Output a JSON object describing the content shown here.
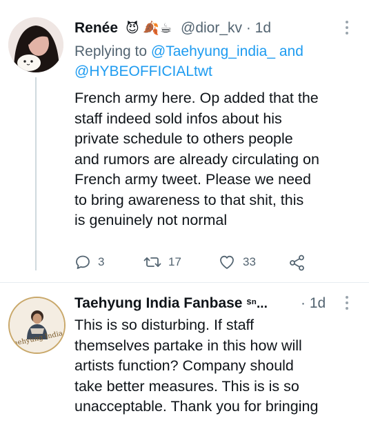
{
  "tweet1": {
    "name": "Renée",
    "emojis": [
      "😈",
      "🍂",
      "☕"
    ],
    "handle": "@dior_kv",
    "time": "· 1d",
    "replying_prefix": "Replying to",
    "replying_to_1": "@Taehyung_india_",
    "replying_and": "and",
    "replying_to_2": "@HYBEOFFICIALtwt",
    "body_lines": [
      "French army here. Op added that the",
      "staff indeed sold infos about his",
      "private schedule to others people",
      "and rumors are already circulating on",
      "French army tweet. Please we need",
      "to bring awareness to that shit, this",
      "is genuinely not normal"
    ],
    "replies": "3",
    "retweets": "17",
    "likes": "33"
  },
  "tweet2": {
    "name": "Taehyung India Fanbase",
    "name_suffix": "ˢⁿ...",
    "time": "· 1d",
    "avatar_text": "Taehyung India",
    "body_lines": [
      "This is so disturbing. If staff",
      "themselves partake in this how will",
      "artists function? Company should",
      "take better measures. This is is so",
      "unacceptable. Thank you for bringing"
    ]
  },
  "colors": {
    "text": "#0f1419",
    "secondary": "#536471",
    "link": "#1d9bf0",
    "thread_line": "#cfd9de"
  }
}
